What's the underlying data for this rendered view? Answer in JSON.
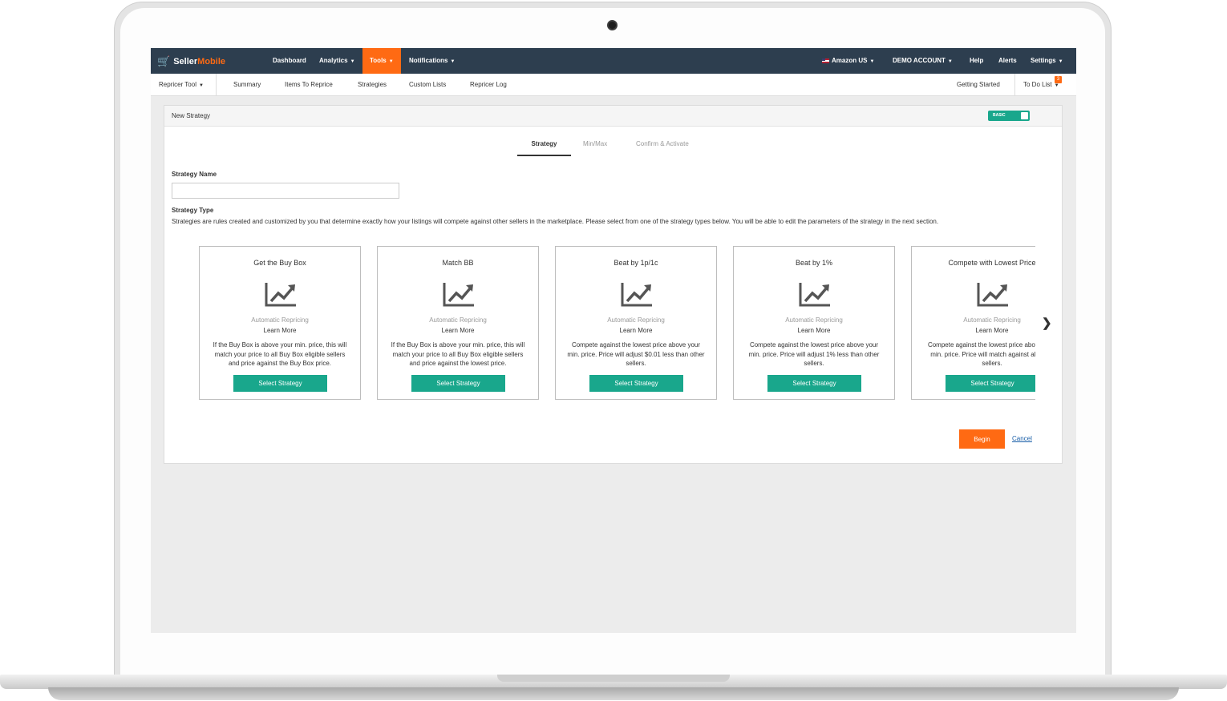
{
  "brand": {
    "part1": "Seller",
    "part2": "Mobile"
  },
  "topnav": {
    "items": [
      "Dashboard",
      "Analytics",
      "Tools",
      "Notifications"
    ],
    "active": "Tools",
    "right": [
      "Amazon US",
      "DEMO ACCOUNT",
      "Help",
      "Alerts",
      "Settings"
    ]
  },
  "subnav": {
    "tool": "Repricer Tool",
    "items": [
      "Summary",
      "Items To Reprice",
      "Strategies",
      "Custom Lists",
      "Repricer Log"
    ],
    "getting_started": "Getting Started",
    "todo": "To Do List",
    "todo_count": "3"
  },
  "panel": {
    "title": "New Strategy",
    "mode_toggle": "BASIC",
    "steps": [
      "Strategy",
      "Min/Max",
      "Confirm & Activate"
    ],
    "active_step": "Strategy",
    "strategy_name_label": "Strategy Name",
    "strategy_name_value": "",
    "strategy_type_label": "Strategy Type",
    "strategy_type_desc": "Strategies are rules created and customized by you that determine exactly how your listings will compete against other sellers in the marketplace. Please select from one of the strategy types below. You will be able to edit the parameters of the strategy in the next section."
  },
  "cards": [
    {
      "title": "Get the Buy Box",
      "subtitle": "Automatic Repricing",
      "learn": "Learn More",
      "desc": "If the Buy Box is above your min. price, this will match your price to all Buy Box eligible sellers and price against the Buy Box price.",
      "button": "Select Strategy"
    },
    {
      "title": "Match BB",
      "subtitle": "Automatic Repricing",
      "learn": "Learn More",
      "desc": "If the Buy Box is above your min. price, this will match your price to all Buy Box eligible sellers and price against the lowest price.",
      "button": "Select Strategy"
    },
    {
      "title": "Beat by 1p/1c",
      "subtitle": "Automatic Repricing",
      "learn": "Learn More",
      "desc": "Compete against the lowest price above your min. price. Price will adjust $0.01 less than other sellers.",
      "button": "Select Strategy"
    },
    {
      "title": "Beat by 1%",
      "subtitle": "Automatic Repricing",
      "learn": "Learn More",
      "desc": "Compete against the lowest price above your min. price. Price will adjust 1% less than other sellers.",
      "button": "Select Strategy"
    },
    {
      "title": "Compete with Lowest Price",
      "subtitle": "Automatic Repricing",
      "learn": "Learn More",
      "desc": "Compete against the lowest price above your min. price. Price will match against all other sellers.",
      "button": "Select Strategy"
    }
  ],
  "actions": {
    "begin": "Begin",
    "cancel": "Cancel"
  },
  "icons": {
    "next": "chevron-right-icon",
    "chart": "trending-up-icon",
    "cart": "shopping-cart-icon"
  },
  "colors": {
    "nav_bg": "#2d3e4f",
    "accent_orange": "#ff6a13",
    "accent_teal": "#19a78c"
  }
}
